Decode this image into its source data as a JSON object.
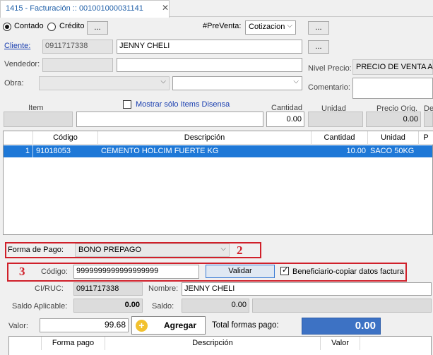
{
  "tab": {
    "title": "1415 - Facturación :: 001001000031141",
    "close": "✕"
  },
  "header": {
    "contado_label": "Contado",
    "credito_label": "Crédito",
    "ellipsis": "...",
    "preventa_label": "#PreVenta:",
    "preventa_value": "Cotizacion",
    "cliente_label": "Cliente:",
    "cliente_id": "0911717338",
    "cliente_name": "JENNY CHELI",
    "vendedor_label": "Vendedor:",
    "vendedor_value": "",
    "nivel_precio_label": "Nivel Precio:",
    "nivel_precio_value": "PRECIO DE VENTA A",
    "obra_label": "Obra:",
    "comentario_label": "Comentario:"
  },
  "item_entry": {
    "item_label": "Item",
    "mostrar_label": "Mostrar sólo Items Disensa",
    "cantidad_label": "Cantidad",
    "cantidad_value": "0.00",
    "unidad_label": "Unidad",
    "precio_orig_label": "Precio Orig.",
    "precio_orig_value": "0.00",
    "de_label": "De"
  },
  "items_grid": {
    "headers": [
      "Código",
      "Descripción",
      "Cantidad",
      "Unidad",
      "P"
    ],
    "rows": [
      {
        "num": "1",
        "codigo": "91018053",
        "descripcion": "CEMENTO HOLCIM FUERTE KG",
        "cantidad": "10.00",
        "unidad": "SACO 50KG"
      }
    ]
  },
  "payment": {
    "forma_pago_label": "Forma de Pago:",
    "forma_pago_value": "BONO PREPAGO",
    "marker_2": "2",
    "marker_3": "3",
    "codigo_label": "Código:",
    "codigo_value": "9999999999999999999",
    "validar_label": "Validar",
    "beneficiario_label": "Beneficiario-copiar datos factura",
    "ciruc_label": "CI/RUC:",
    "ciruc_value": "0911717338",
    "nombre_label": "Nombre:",
    "nombre_value": "JENNY CHELI",
    "saldo_aplicable_label": "Saldo Aplicable:",
    "saldo_aplicable_value": "0.00",
    "saldo_label": "Saldo:",
    "saldo_value": "0.00",
    "valor_label": "Valor:",
    "valor_value": "99.68",
    "agregar_label": "Agregar",
    "total_label": "Total formas pago:",
    "total_value": "0.00"
  },
  "payments_grid": {
    "headers": [
      "Forma pago",
      "Descripción",
      "Valor"
    ]
  },
  "colors": {
    "accent": "#1e78d7",
    "marker": "#d0202a",
    "total_box": "#3d72c4"
  }
}
